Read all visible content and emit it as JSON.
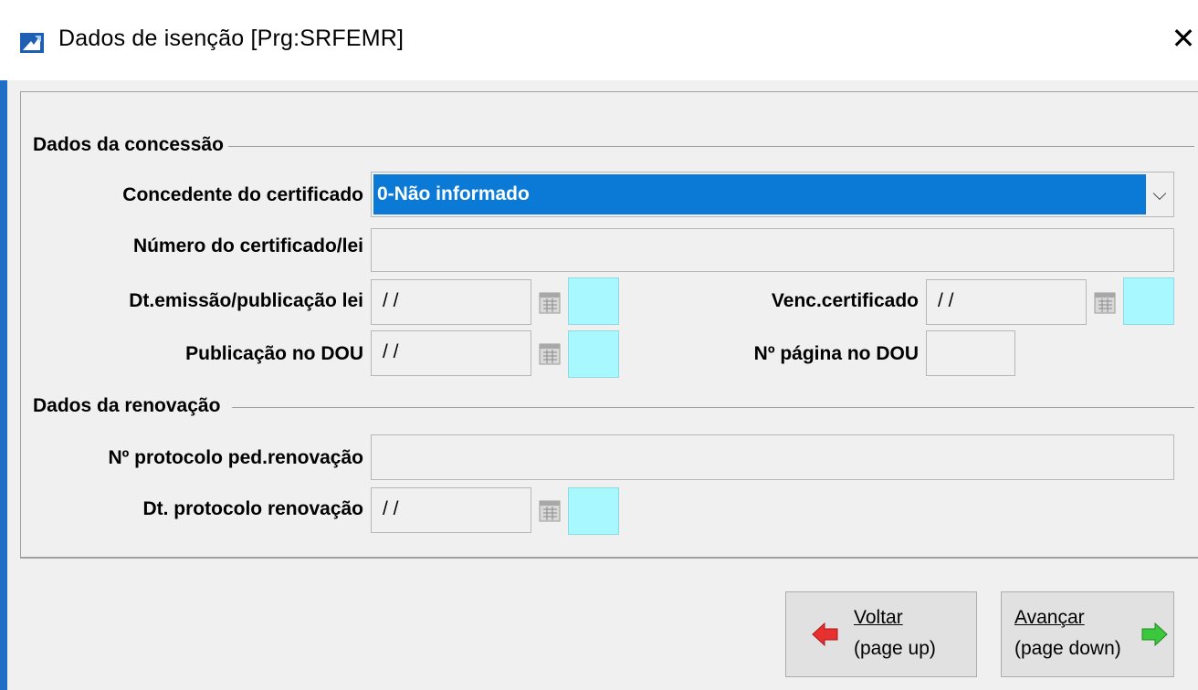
{
  "window": {
    "title": "Dados de isenção [Prg:SRFEMR]",
    "close_glyph": "✕"
  },
  "concessao": {
    "group_title": "Dados da concessão",
    "concedente": {
      "label": "Concedente do certificado",
      "value": "0-Não informado"
    },
    "numero": {
      "label": "Número do certificado/lei",
      "value": ""
    },
    "dt_emissao": {
      "label": "Dt.emissão/publicação lei",
      "value": " / /"
    },
    "venc": {
      "label": "Venc.certificado",
      "value": " / /"
    },
    "publicacao": {
      "label": "Publicação no DOU",
      "value": " / /"
    },
    "pagina": {
      "label": "Nº página no DOU",
      "value": ""
    }
  },
  "renovacao": {
    "group_title": "Dados da renovação",
    "protocolo": {
      "label": "Nº protocolo ped.renovação",
      "value": ""
    },
    "dt_protocolo": {
      "label": "Dt. protocolo renovação",
      "value": " / /"
    }
  },
  "buttons": {
    "voltar": {
      "line1": "Voltar",
      "line2": "(page up)"
    },
    "avancar": {
      "line1": "Avançar",
      "line2": "(page down)"
    }
  },
  "icons": {
    "app": "app-icon",
    "calendar": "calendar-icon",
    "back": "arrow-left-icon",
    "forward": "arrow-right-icon"
  },
  "colors": {
    "selection": "#0a7ad6",
    "swatch": "#a8f8ff",
    "back_arrow": "#e83030",
    "forward_arrow": "#3cc83c"
  }
}
